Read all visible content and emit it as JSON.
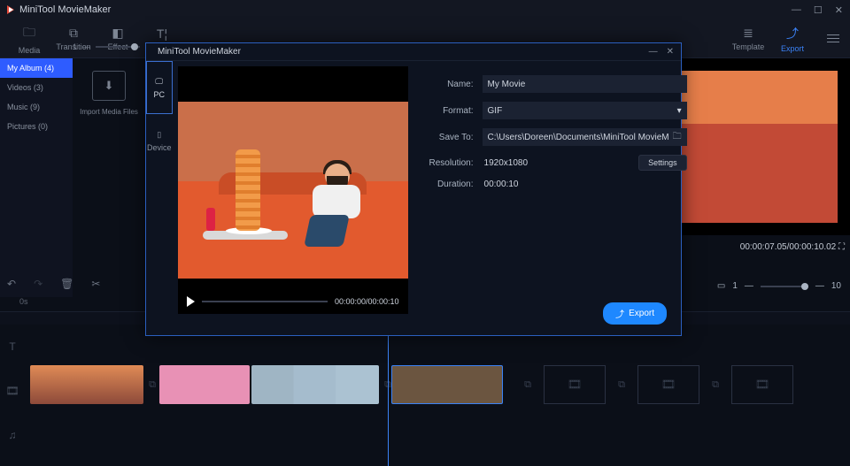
{
  "app": {
    "title": "MiniTool MovieMaker"
  },
  "toolbar": {
    "media": "Media",
    "transition": "Transition",
    "effect": "Effect",
    "text": "Text",
    "template": "Template",
    "export": "Export"
  },
  "sidebar": {
    "items": [
      {
        "label": "My Album",
        "count": "(4)"
      },
      {
        "label": "Videos",
        "count": "(3)"
      },
      {
        "label": "Music",
        "count": "(9)"
      },
      {
        "label": "Pictures",
        "count": "(0)"
      }
    ],
    "import": "Import Media Files",
    "thumb_slider": "1"
  },
  "preview": {
    "time": "00:00:07.05/00:00:10.02",
    "zoom_min": "1",
    "zoom_max": "10"
  },
  "timeline": {
    "zero": "0s"
  },
  "modal": {
    "title": "MiniTool MovieMaker",
    "tabs": {
      "pc": "PC",
      "device": "Device"
    },
    "preview_time": "00:00:00/00:00:10",
    "fields": {
      "name_label": "Name:",
      "name_value": "My Movie",
      "format_label": "Format:",
      "format_value": "GIF",
      "saveto_label": "Save To:",
      "saveto_value": "C:\\Users\\Doreen\\Documents\\MiniTool MovieM",
      "resolution_label": "Resolution:",
      "resolution_value": "1920x1080",
      "settings_btn": "Settings",
      "duration_label": "Duration:",
      "duration_value": "00:00:10"
    },
    "export_btn": "Export"
  }
}
